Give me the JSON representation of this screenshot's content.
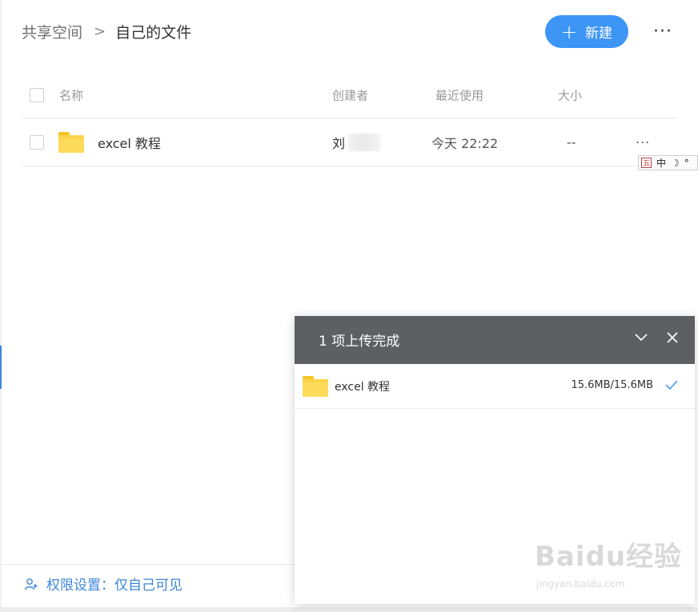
{
  "breadcrumb": {
    "root": "共享空间",
    "separator": ">",
    "current": "自己的文件"
  },
  "toolbar": {
    "new_plus": "+",
    "new_label": "新建",
    "more": "···"
  },
  "table": {
    "headers": {
      "name": "名称",
      "creator": "创建者",
      "last_used": "最近使用",
      "size": "大小"
    },
    "rows": [
      {
        "name": "excel 教程",
        "creator": "刘",
        "last_used": "今天 22:22",
        "size": "--",
        "more": "···"
      }
    ]
  },
  "ime": {
    "box": "五",
    "lang": "中",
    "moon": "☽",
    "dot": "°"
  },
  "footer": {
    "permission": "权限设置：仅自己可见"
  },
  "upload": {
    "title": "1 项上传完成",
    "items": [
      {
        "name": "excel 教程",
        "size": "15.6MB/15.6MB"
      }
    ]
  },
  "watermark": {
    "main": "Baidu经验",
    "sub": "jingyan.baidu.com"
  },
  "colors": {
    "accent": "#3d96f5",
    "link": "#3d86d6",
    "folder": "#fcd44a",
    "panel_header": "#5d5f63"
  }
}
